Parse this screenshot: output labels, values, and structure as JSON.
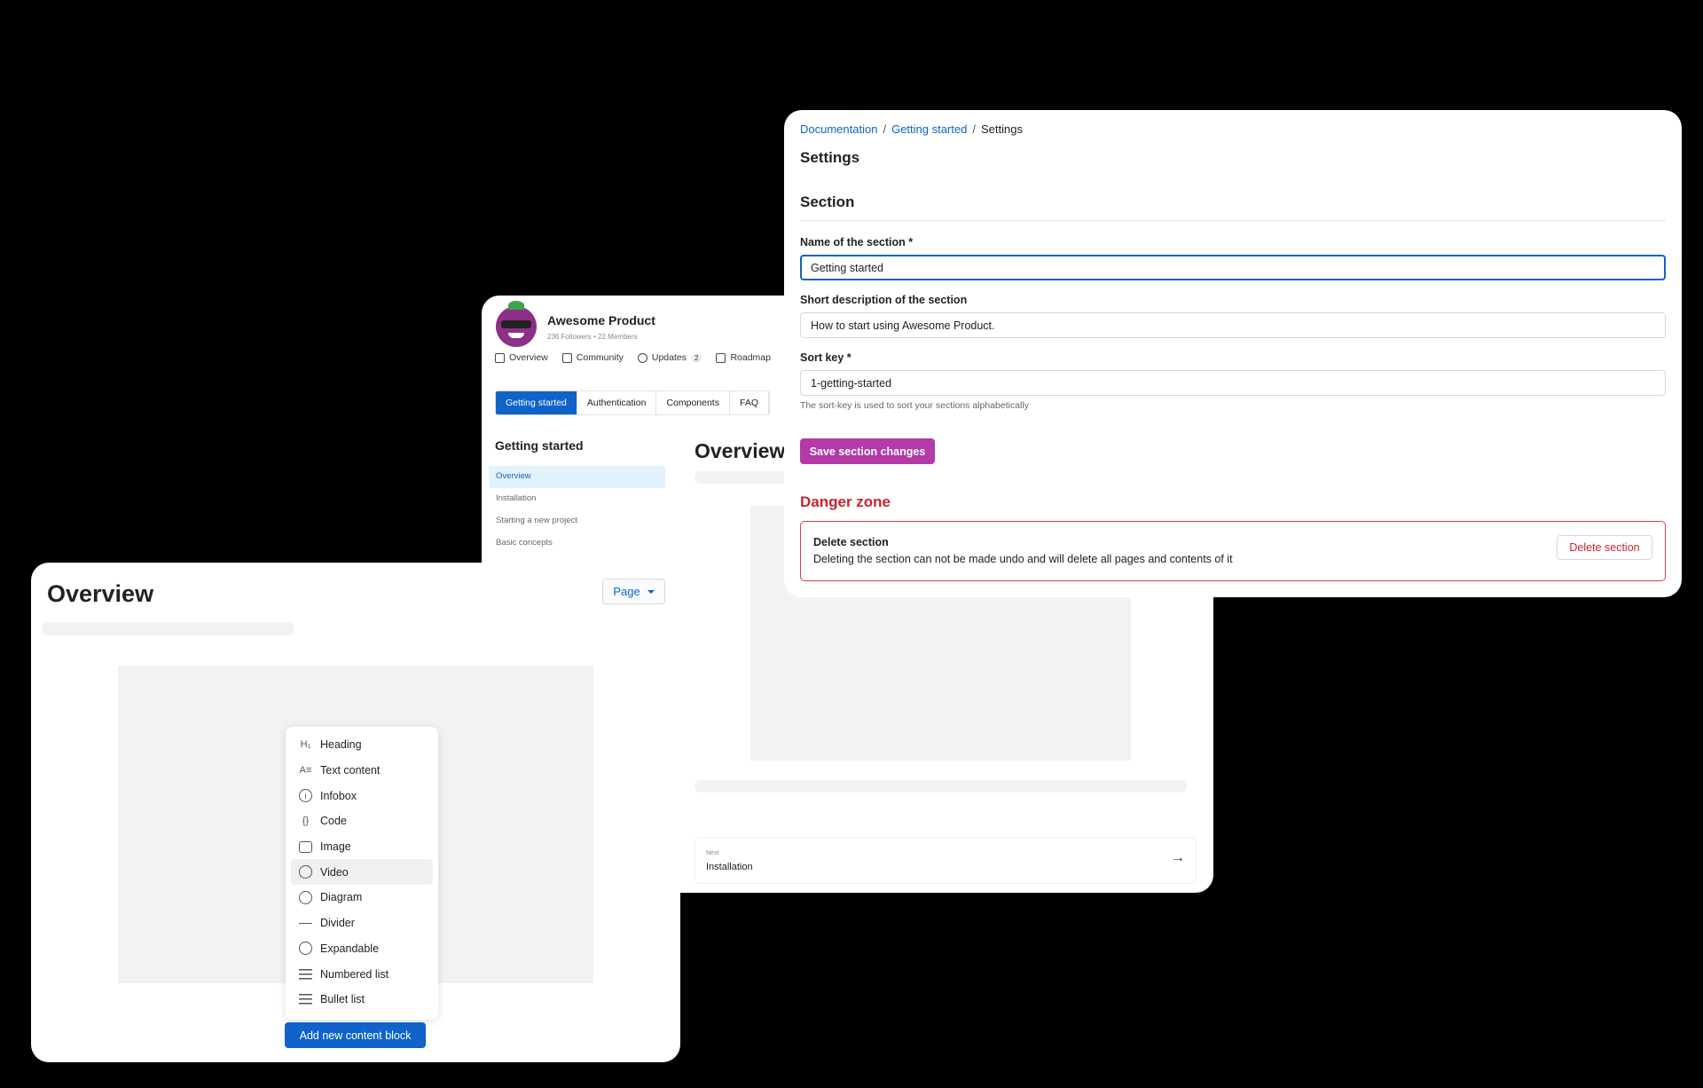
{
  "product_page": {
    "name": "Awesome Product",
    "meta": "236 Followers • 22 Members",
    "nav": [
      {
        "label": "Overview"
      },
      {
        "label": "Community"
      },
      {
        "label": "Updates",
        "badge": "2"
      },
      {
        "label": "Roadmap"
      }
    ],
    "tabs": [
      "Getting started",
      "Authentication",
      "Components",
      "FAQ"
    ],
    "sidebar_title": "Getting started",
    "sidebar_items": [
      "Overview",
      "Installation",
      "Starting a new project",
      "Basic concepts"
    ],
    "main_title": "Overview",
    "next": {
      "label": "Next",
      "value": "Installation",
      "arrow": "→"
    }
  },
  "overview_editor": {
    "title": "Overview",
    "page_button": "Page",
    "menu_items": [
      {
        "label": "Heading",
        "icon": "heading-icon",
        "glyph": "H₁"
      },
      {
        "label": "Text content",
        "icon": "text-content-icon",
        "glyph": "A≡"
      },
      {
        "label": "Infobox",
        "icon": "info-icon",
        "glyph": "i"
      },
      {
        "label": "Code",
        "icon": "code-icon",
        "glyph": "{}"
      },
      {
        "label": "Image",
        "icon": "image-icon",
        "glyph": ""
      },
      {
        "label": "Video",
        "icon": "video-icon",
        "glyph": ""
      },
      {
        "label": "Diagram",
        "icon": "diagram-icon",
        "glyph": ""
      },
      {
        "label": "Divider",
        "icon": "divider-icon",
        "glyph": ""
      },
      {
        "label": "Expandable",
        "icon": "expandable-icon",
        "glyph": ""
      },
      {
        "label": "Numbered list",
        "icon": "numbered-list-icon",
        "glyph": ""
      },
      {
        "label": "Bullet list",
        "icon": "bullet-list-icon",
        "glyph": ""
      }
    ],
    "hovered_item": "Video",
    "add_button": "Add new content block"
  },
  "settings": {
    "breadcrumb": [
      "Documentation",
      "Getting started",
      "Settings"
    ],
    "breadcrumb_sep": "/",
    "title": "Settings",
    "section_title": "Section",
    "fields": {
      "name_label": "Name of the section *",
      "name_value": "Getting started",
      "desc_label": "Short description of the section",
      "desc_value": "How to start using Awesome Product.",
      "sort_label": "Sort key *",
      "sort_value": "1-getting-started",
      "sort_help": "The sort-key is used to sort your sections alphabetically"
    },
    "save_button": "Save section changes",
    "danger_title": "Danger zone",
    "danger_label": "Delete section",
    "danger_desc": "Deleting the section can not be made undo and will delete all pages and contents of it",
    "delete_button": "Delete section"
  },
  "colors": {
    "primary": "#0f63c9",
    "save": "#b33aa7",
    "danger": "#c9242f",
    "background": "#000000"
  }
}
